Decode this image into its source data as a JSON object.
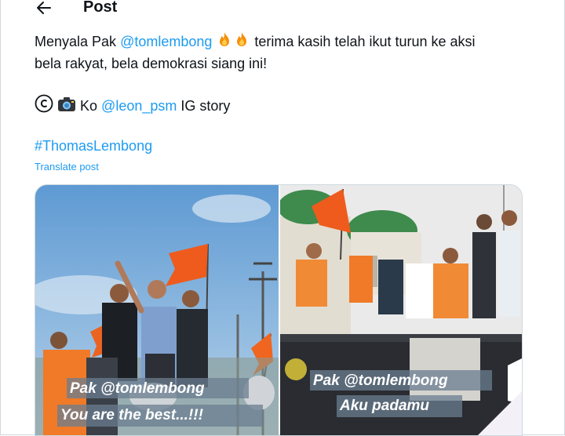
{
  "header": {
    "title": "Post",
    "back_icon": "arrow-left-icon"
  },
  "tweet": {
    "line1_prefix": "Menyala Pak ",
    "line1_mention": "@tomlembong",
    "line1_suffix": " terima kasih telah ikut turun ke aksi",
    "line2": "bela rakyat, bela demokrasi siang ini!",
    "line3_prefix": " Ko ",
    "line3_mention": "@leon_psm",
    "line3_suffix": " IG story",
    "hashtag": "#ThomasLembong",
    "icons": [
      "fire-icon",
      "fire-icon",
      "copyright-icon",
      "camera-icon"
    ]
  },
  "translate_label": "Translate post",
  "media": {
    "left_caption_line1": "Pak @tomlembong",
    "left_caption_line2": "You are the best...!!!",
    "right_caption_line1": "Pak @tomlembong",
    "right_caption_line2": "Aku padamu"
  },
  "colors": {
    "accent": "#1d9bf0",
    "text": "#0f1419",
    "border": "#cfd9de"
  }
}
